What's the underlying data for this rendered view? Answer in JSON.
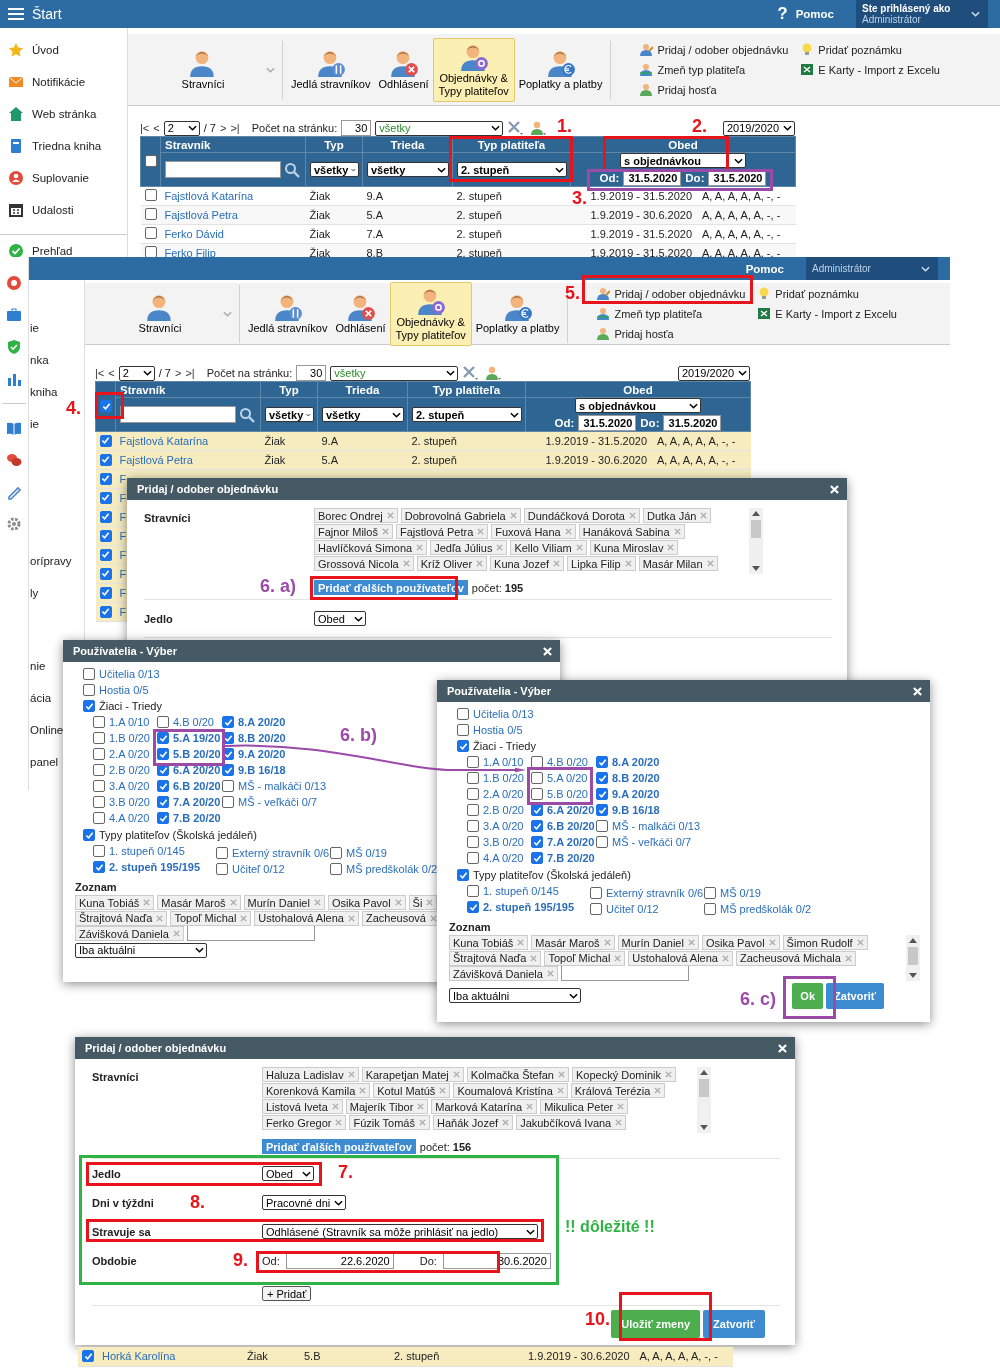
{
  "top_screen": {
    "title": "Štart",
    "help_icon": "?",
    "help": "Pomoc",
    "user_label": "Ste prihlásený ako",
    "user_name": "Administrátor",
    "sidebar": [
      {
        "label": "Úvod"
      },
      {
        "label": "Notifikácie"
      },
      {
        "label": "Web stránka"
      },
      {
        "label": "Triedna kniha"
      },
      {
        "label": "Suplovanie"
      },
      {
        "label": "Udalosti"
      },
      {
        "label": "Prehľad"
      }
    ],
    "toolbar": {
      "buttons": [
        {
          "label": "Stravníci",
          "selected": false
        },
        {
          "label": "Jedlá stravníkov",
          "selected": false
        },
        {
          "label": "Odhlásení",
          "selected": false
        },
        {
          "label": "Objednávky & Typy platiteľov",
          "selected": true
        },
        {
          "label": "Poplatky a platby",
          "selected": false
        }
      ],
      "actions": [
        {
          "label": "Pridaj / odober objednávku"
        },
        {
          "label": "Zmeň typ platiteľa"
        },
        {
          "label": "Pridaj hosťa"
        },
        {
          "label": "Pridať poznámku"
        },
        {
          "label": "E Karty - Import z Excelu"
        }
      ]
    },
    "pager": {
      "first": "|<",
      "prev": "<",
      "page": "2",
      "total": "/ 7",
      "next": ">",
      "last": ">|",
      "per_page_label": "Počet na stránku:",
      "per_page": "30",
      "filter": "všetky",
      "year": "2019/2020"
    },
    "table": {
      "select_all": false,
      "columns": [
        "Stravník",
        "Typ",
        "Trieda",
        "Typ platiteľa",
        "Obed"
      ],
      "filters": {
        "type": "všetky",
        "class": "všetky",
        "payer": "2. stupeň",
        "meal": "s objednávkou",
        "from_label": "Od:",
        "from": "31.5.2020",
        "to_label": "Do:",
        "to": "31.5.2020"
      },
      "rows": [
        {
          "checked": false,
          "name": "Fajstlová Katarína",
          "type": "Žiak",
          "class": "9.A",
          "payer": "2. stupeň",
          "period": "1.9.2019 - 31.5.2020",
          "days": "A, A, A, A, A, -, -"
        },
        {
          "checked": false,
          "name": "Fajstlová Petra",
          "type": "Žiak",
          "class": "5.A",
          "payer": "2. stupeň",
          "period": "1.9.2019 - 30.6.2020",
          "days": "A, A, A, A, A, -, -"
        },
        {
          "checked": false,
          "name": "Ferko Dávid",
          "type": "Žiak",
          "class": "7.A",
          "payer": "2. stupeň",
          "period": "1.9.2019 - 31.5.2020",
          "days": "A, A, A, A, A, -, -"
        },
        {
          "checked": false,
          "name": "Ferko Filip",
          "type": "Žiak",
          "class": "8.B",
          "payer": "2. stupeň",
          "period": "1.9.2019 - 31.5.2020",
          "days": "A, A, A, A, A, -, -"
        }
      ]
    }
  },
  "second_screen": {
    "help": "Pomoc",
    "user_name": "Administrátor",
    "sidebar": [
      {
        "label": "ie"
      },
      {
        "label": "nka"
      },
      {
        "label": "kniha"
      },
      {
        "label": "ie"
      },
      {
        "label": "orípravy"
      },
      {
        "label": "ly"
      },
      {
        "label": "nie"
      },
      {
        "label": "ácia"
      },
      {
        "label": "Online"
      },
      {
        "label": "panel"
      }
    ],
    "toolbar": {
      "buttons": [
        {
          "label": "Stravníci",
          "selected": false
        },
        {
          "label": "Jedlá stravníkov",
          "selected": false
        },
        {
          "label": "Odhlásení",
          "selected": false
        },
        {
          "label": "Objednávky & Typy platiteľov",
          "selected": true
        },
        {
          "label": "Poplatky a platby",
          "selected": false
        }
      ],
      "actions": [
        {
          "label": "Pridaj / odober objednávku"
        },
        {
          "label": "Zmeň typ platiteľa"
        },
        {
          "label": "Pridaj hosťa"
        },
        {
          "label": "Pridať poznámku"
        },
        {
          "label": "E Karty - Import z Excelu"
        }
      ]
    },
    "pager": {
      "first": "|<",
      "prev": "<",
      "page": "2",
      "total": "/ 7",
      "next": ">",
      "last": ">|",
      "per_page_label": "Počet na stránku:",
      "per_page": "30",
      "filter": "všetky",
      "year": "2019/2020"
    },
    "table": {
      "select_all": true,
      "columns": [
        "Stravník",
        "Typ",
        "Trieda",
        "Typ platiteľa",
        "Obed"
      ],
      "filters": {
        "type": "všetky",
        "class": "všetky",
        "payer": "2. stupeň",
        "meal": "s objednávkou",
        "from_label": "Od:",
        "from": "31.5.2020",
        "to_label": "Do:",
        "to": "31.5.2020"
      },
      "rows": [
        {
          "checked": true,
          "name": "Fajstlová Katarína",
          "type": "Žiak",
          "class": "9.A",
          "payer": "2. stupeň",
          "period": "1.9.2019 - 31.5.2020",
          "days": "A, A, A, A, A, -, -"
        },
        {
          "checked": true,
          "name": "Fajstlová Petra",
          "type": "Žiak",
          "class": "5.A",
          "payer": "2. stupeň",
          "period": "1.9.2019 - 30.6.2020",
          "days": "A, A, A, A, A, -, -"
        },
        {
          "checked": true,
          "name": "F"
        },
        {
          "checked": true,
          "name": "F"
        },
        {
          "checked": true,
          "name": "F"
        },
        {
          "checked": true,
          "name": "F"
        },
        {
          "checked": true,
          "name": "F"
        },
        {
          "checked": true,
          "name": "F"
        },
        {
          "checked": true,
          "name": "F"
        },
        {
          "checked": true,
          "name": "F"
        }
      ]
    }
  },
  "order_dialog": {
    "title": "Pridaj / odober objednávku",
    "diners_label": "Stravníci",
    "tag_rows": [
      [
        "Borec Ondrej",
        "Dobrovolná Gabriela",
        "Dundáčková Dorota",
        "Dutka Ján"
      ],
      [
        "Fajnor Miloš",
        "Fajstlová Petra",
        "Fuxová Hana",
        "Hanáková Sabina"
      ],
      [
        "Havlíčková Simona",
        "Jedľa Július",
        "Kello Viliam",
        "Kuna Miroslav"
      ],
      [
        "Grossová Nicola",
        "Kríž Oliver",
        "Kuna Jozef",
        "Lipka Filip",
        "Masár Milan"
      ]
    ],
    "add_button": "Pridať ďalších používateľov",
    "count": "počet: **195**",
    "fields": [
      {
        "kind": "select",
        "label": "Jedlo",
        "value": "Obed"
      }
    ]
  },
  "user_pickers": [
    {
      "title": "Používatelia - Výber",
      "categories": [
        {
          "label": "Učitelia 0/13",
          "checked": false
        },
        {
          "label": "Hostia 0/5",
          "checked": false
        }
      ],
      "students": {
        "label": "Žiaci - Triedy",
        "checked": true,
        "columns": [
          [
            {
              "label": "1.A 0/10",
              "checked": false
            },
            {
              "label": "1.B 0/20",
              "checked": false
            },
            {
              "label": "2.A 0/20",
              "checked": false
            },
            {
              "label": "2.B 0/20",
              "checked": false
            },
            {
              "label": "3.A 0/20",
              "checked": false
            },
            {
              "label": "3.B 0/20",
              "checked": false
            },
            {
              "label": "4.A 0/20",
              "checked": false
            }
          ],
          [
            {
              "label": "4.B 0/20",
              "checked": false
            },
            {
              "label": "5.A 19/20",
              "checked": true
            },
            {
              "label": "5.B 20/20",
              "checked": true
            },
            {
              "label": "6.A 20/20",
              "checked": true
            },
            {
              "label": "6.B 20/20",
              "checked": true
            },
            {
              "label": "7.A 20/20",
              "checked": true
            },
            {
              "label": "7.B 20/20",
              "checked": true
            }
          ],
          [
            {
              "label": "8.A 20/20",
              "checked": true
            },
            {
              "label": "8.B 20/20",
              "checked": true
            },
            {
              "label": "9.A 20/20",
              "checked": true
            },
            {
              "label": "9.B 16/18",
              "checked": true
            },
            {
              "label": "MŠ - malkáči 0/13",
              "checked": false
            },
            {
              "label": "MŠ - veľkáči 0/7",
              "checked": false
            }
          ]
        ]
      },
      "payers": {
        "label": "Typy platiteľov (Školská jedáleň)",
        "checked": true,
        "columns": [
          [
            {
              "label": "1. stupeň 0/145",
              "checked": false
            },
            {
              "label": "2. stupeň 195/195",
              "checked": true
            }
          ],
          [
            {
              "label": "Externý stravník 0/6",
              "checked": false
            },
            {
              "label": "Učiteľ 0/12",
              "checked": false
            }
          ],
          [
            {
              "label": "MŠ 0/19",
              "checked": false
            },
            {
              "label": "MŠ predškolák 0/2",
              "checked": false
            }
          ]
        ]
      },
      "list_label": "Zoznam",
      "tag_rows": [
        [
          "Kuna Tobiáš",
          "Masár Maroš",
          "Murín Daniel",
          "Osika Pavol",
          "Ši"
        ],
        [
          "Štrajtová Naďa",
          "Topoľ Michal",
          "Ustohalová Alena",
          "Zacheusová"
        ],
        [
          "Závišková Daniela"
        ]
      ],
      "filter": "Iba aktuálni"
    },
    {
      "title": "Používatelia - Výber",
      "categories": [
        {
          "label": "Učitelia 0/13",
          "checked": false
        },
        {
          "label": "Hostia 0/5",
          "checked": false
        }
      ],
      "students": {
        "label": "Žiaci - Triedy",
        "checked": true,
        "columns": [
          [
            {
              "label": "1.A 0/10",
              "checked": false
            },
            {
              "label": "1.B 0/20",
              "checked": false
            },
            {
              "label": "2.A 0/20",
              "checked": false
            },
            {
              "label": "2.B 0/20",
              "checked": false
            },
            {
              "label": "3.A 0/20",
              "checked": false
            },
            {
              "label": "3.B 0/20",
              "checked": false
            },
            {
              "label": "4.A 0/20",
              "checked": false
            }
          ],
          [
            {
              "label": "4.B 0/20",
              "checked": false
            },
            {
              "label": "5.A 0/20",
              "checked": false
            },
            {
              "label": "5.B 0/20",
              "checked": false
            },
            {
              "label": "6.A 20/20",
              "checked": true
            },
            {
              "label": "6.B 20/20",
              "checked": true
            },
            {
              "label": "7.A 20/20",
              "checked": true
            },
            {
              "label": "7.B 20/20",
              "checked": true
            }
          ],
          [
            {
              "label": "8.A 20/20",
              "checked": true
            },
            {
              "label": "8.B 20/20",
              "checked": true
            },
            {
              "label": "9.A 20/20",
              "checked": true
            },
            {
              "label": "9.B 16/18",
              "checked": true
            },
            {
              "label": "MŠ - malkáči 0/13",
              "checked": false
            },
            {
              "label": "MŠ - veľkáči 0/7",
              "checked": false
            }
          ]
        ]
      },
      "payers": {
        "label": "Typy platiteľov (Školská jedáleň)",
        "checked": true,
        "columns": [
          [
            {
              "label": "1. stupeň 0/145",
              "checked": false
            },
            {
              "label": "2. stupeň 195/195",
              "checked": true
            }
          ],
          [
            {
              "label": "Externý stravník 0/6",
              "checked": false
            },
            {
              "label": "Učiteľ 0/12",
              "checked": false
            }
          ],
          [
            {
              "label": "MŠ 0/19",
              "checked": false
            },
            {
              "label": "MŠ predškolák 0/2",
              "checked": false
            }
          ]
        ]
      },
      "list_label": "Zoznam",
      "tag_rows": [
        [
          "Kuna Tobiáš",
          "Masár Maroš",
          "Murín Daniel",
          "Osika Pavol",
          "Šimon Rudolf"
        ],
        [
          "Štrajtová Naďa",
          "Topoľ Michal",
          "Ustohalová Alena",
          "Zacheusová Michala"
        ],
        [
          "Závišková Daniela"
        ]
      ],
      "filter": "Iba aktuálni",
      "buttons": [
        {
          "label": "Ok",
          "kind": "primary"
        },
        {
          "label": "Zatvoriť",
          "kind": "secondary"
        }
      ]
    }
  ],
  "final_dialog": {
    "title": "Pridaj / odober objednávku",
    "diners_label": "Stravníci",
    "tag_rows": [
      [
        "Haluza Ladislav",
        "Karapetjan Matej",
        "Kolmačka Štefan",
        "Kopecký Dominik"
      ],
      [
        "Korenková Kamila",
        "Kotul Matúš",
        "Koumalová Kristína",
        "Králová Terézia"
      ],
      [
        "Listová Iveta",
        "Majerík Tibor",
        "Marková Katarína",
        "Mikulica Peter"
      ],
      [
        "Ferko Gregor",
        "Fúzik Tomáš",
        "Haňák Jozef",
        "Jakubčíková Ivana"
      ]
    ],
    "add_button": "Pridať ďalších používateľov",
    "count": "počet: **156**",
    "fields": [
      {
        "kind": "select",
        "label": "Jedlo",
        "value": "Obed"
      },
      {
        "kind": "select",
        "label": "Dni v týždni",
        "value": "Pracovné dni"
      },
      {
        "kind": "select",
        "label": "Stravuje sa",
        "value": "Odhlásené (Stravník sa môže prihlásiť na jedlo)"
      },
      {
        "kind": "range",
        "label": "Obdobie",
        "from_label": "Od:",
        "from": "22.6.2020",
        "to_label": "Do:",
        "to": "30.6.2020"
      }
    ],
    "add_period": "+ Pridať",
    "buttons": [
      {
        "label": "Uložiť zmeny",
        "kind": "primary"
      },
      {
        "label": "Zatvoriť",
        "kind": "secondary"
      }
    ]
  },
  "bottom_row": {
    "checked": true,
    "name": "Horká Karolína",
    "type": "Žiak",
    "class": "5.B",
    "payer": "2. stupeň",
    "period": "1.9.2019 - 30.6.2020",
    "days": "A, A, A, A, A, -, -"
  },
  "annotations": [
    {
      "label": "1.",
      "color": "#e8141c"
    },
    {
      "label": "2.",
      "color": "#e8141c"
    },
    {
      "label": "3.",
      "color": "#e8141c"
    },
    {
      "label": "4.",
      "color": "#e8141c"
    },
    {
      "label": "5.",
      "color": "#e8141c"
    },
    {
      "label": "6. a)",
      "color": "#9b4aa8"
    },
    {
      "label": "6. b)",
      "color": "#9b4aa8"
    },
    {
      "label": "6. c)",
      "color": "#9b4aa8"
    },
    {
      "label": "7.",
      "color": "#e8141c"
    },
    {
      "label": "8.",
      "color": "#e8141c"
    },
    {
      "label": "9.",
      "color": "#e8141c"
    },
    {
      "label": "10.",
      "color": "#e8141c"
    },
    {
      "label": "!!  dôležité  !!",
      "color": "#2fb344"
    }
  ],
  "highlights": [
    {
      "color": "#e8141c"
    },
    {
      "color": "#e8141c"
    },
    {
      "color": "#9b4aa8"
    },
    {
      "color": "#e8141c"
    },
    {
      "color": "#e8141c"
    },
    {
      "color": "#e8141c"
    },
    {
      "color": "#9b4aa8"
    },
    {
      "color": "#9b4aa8"
    },
    {
      "color": "#9b4aa8"
    },
    {
      "color": "#2fb344"
    },
    {
      "color": "#e8141c"
    },
    {
      "color": "#e8141c"
    },
    {
      "color": "#e8141c"
    },
    {
      "color": "#e8141c"
    }
  ],
  "arrow": {
    "color": "#9b4aa8"
  }
}
